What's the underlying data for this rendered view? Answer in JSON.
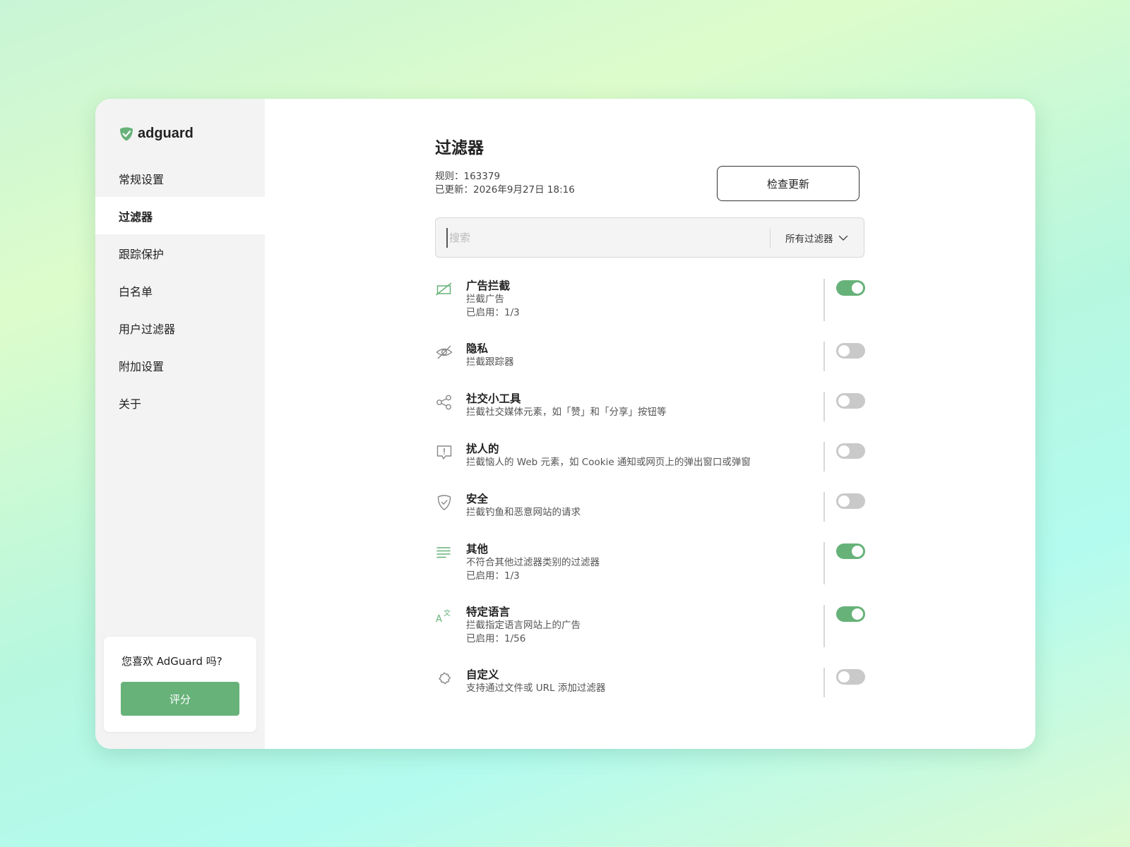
{
  "app": {
    "logo_text": "adguard"
  },
  "sidebar": {
    "items": [
      {
        "label": "常规设置",
        "active": false
      },
      {
        "label": "过滤器",
        "active": true
      },
      {
        "label": "跟踪保护",
        "active": false
      },
      {
        "label": "白名单",
        "active": false
      },
      {
        "label": "用户过滤器",
        "active": false
      },
      {
        "label": "附加设置",
        "active": false
      },
      {
        "label": "关于",
        "active": false
      }
    ],
    "rate_card": {
      "question": "您喜欢 AdGuard 吗?",
      "button_label": "评分"
    }
  },
  "main": {
    "title": "过滤器",
    "rules_line": "规则：163379",
    "updated_line": "已更新：2026年9月27日 18:16",
    "check_updates_label": "检查更新",
    "search": {
      "placeholder": "搜索",
      "value": ""
    },
    "filter_select": {
      "selected": "所有过滤器"
    },
    "filters": [
      {
        "icon": "ad-block-icon",
        "name": "广告拦截",
        "desc": "拦截广告",
        "enabled": "已启用：1/3",
        "on": true
      },
      {
        "icon": "privacy-eye-icon",
        "name": "隐私",
        "desc": "拦截跟踪器",
        "enabled": "",
        "on": false
      },
      {
        "icon": "share-icon",
        "name": "社交小工具",
        "desc": "拦截社交媒体元素，如「赞」和「分享」按钮等",
        "enabled": "",
        "on": false
      },
      {
        "icon": "alert-message-icon",
        "name": "扰人的",
        "desc": "拦截恼人的 Web 元素，如 Cookie 通知或网页上的弹出窗口或弹窗",
        "enabled": "",
        "on": false
      },
      {
        "icon": "shield-check-icon",
        "name": "安全",
        "desc": "拦截钓鱼和恶意网站的请求",
        "enabled": "",
        "on": false
      },
      {
        "icon": "lines-icon",
        "name": "其他",
        "desc": "不符合其他过滤器类别的过滤器",
        "enabled": "已启用：1/3",
        "on": true
      },
      {
        "icon": "translate-icon",
        "name": "特定语言",
        "desc": "拦截指定语言网站上的广告",
        "enabled": "已启用：1/56",
        "on": true
      },
      {
        "icon": "puzzle-icon",
        "name": "自定义",
        "desc": "支持通过文件或 URL 添加过滤器",
        "enabled": "",
        "on": false
      }
    ]
  },
  "colors": {
    "accent": "#67b279",
    "toggle_off": "#c9c9c9",
    "sidebar_bg": "#f3f3f3"
  }
}
